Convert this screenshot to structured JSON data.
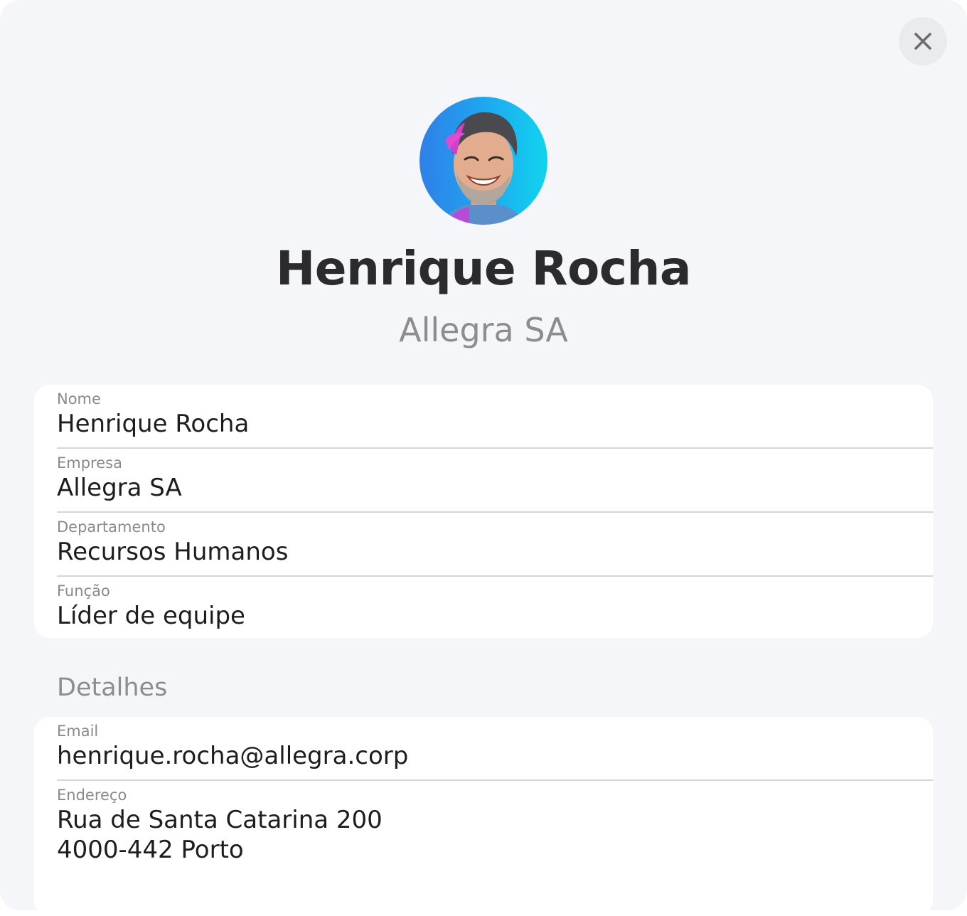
{
  "profile": {
    "name": "Henrique Rocha",
    "company": "Allegra SA",
    "avatar_icon": "person-portrait"
  },
  "close_icon": "close-icon",
  "primary_fields": [
    {
      "label": "Nome",
      "value": "Henrique Rocha"
    },
    {
      "label": "Empresa",
      "value": "Allegra SA"
    },
    {
      "label": "Departamento",
      "value": "Recursos Humanos"
    },
    {
      "label": "Função",
      "value": "Líder de equipe"
    }
  ],
  "details": {
    "heading": "Detalhes",
    "email": {
      "label": "Email",
      "value": "henrique.rocha@allegra.corp"
    },
    "address": {
      "label": "Endereço",
      "line1": "Rua de Santa Catarina 200",
      "line2": "4000-442 Porto"
    }
  },
  "colors": {
    "background": "#f4f6f9",
    "card": "#ffffff",
    "title": "#2b2b2d",
    "muted": "#8d8d90",
    "divider": "#d6d6d8"
  }
}
